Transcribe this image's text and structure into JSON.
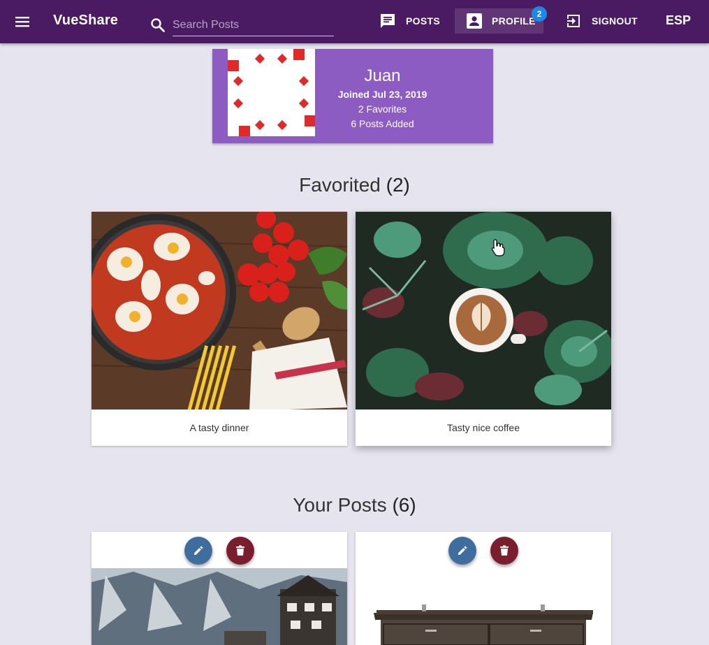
{
  "toolbar": {
    "title": "VueShare",
    "search_placeholder": "Search Posts",
    "nav": {
      "posts": "POSTS",
      "profile": "PROFILE",
      "signout": "SIGNOUT"
    },
    "profile_badge": "2",
    "language": "ESP",
    "colors": {
      "bar": "#4a1a63",
      "badge": "#1e88e5"
    }
  },
  "profile": {
    "name": "Juan",
    "joined": "Joined Jul 23, 2019",
    "favorites": "2 Favorites",
    "posts_added": "6 Posts Added",
    "card_color": "#8c5cc2"
  },
  "favorited": {
    "heading": "Favorited",
    "count": "(2)",
    "items": [
      {
        "caption": "A tasty dinner",
        "image": "shakshuka-dinner-photo"
      },
      {
        "caption": "Tasty nice coffee",
        "image": "coffee-succulents-photo"
      }
    ]
  },
  "your_posts": {
    "heading": "Your Posts",
    "count": "(6)",
    "items": [
      {
        "image": "mountain-village-photo"
      },
      {
        "image": "wooden-dresser-photo"
      }
    ]
  }
}
